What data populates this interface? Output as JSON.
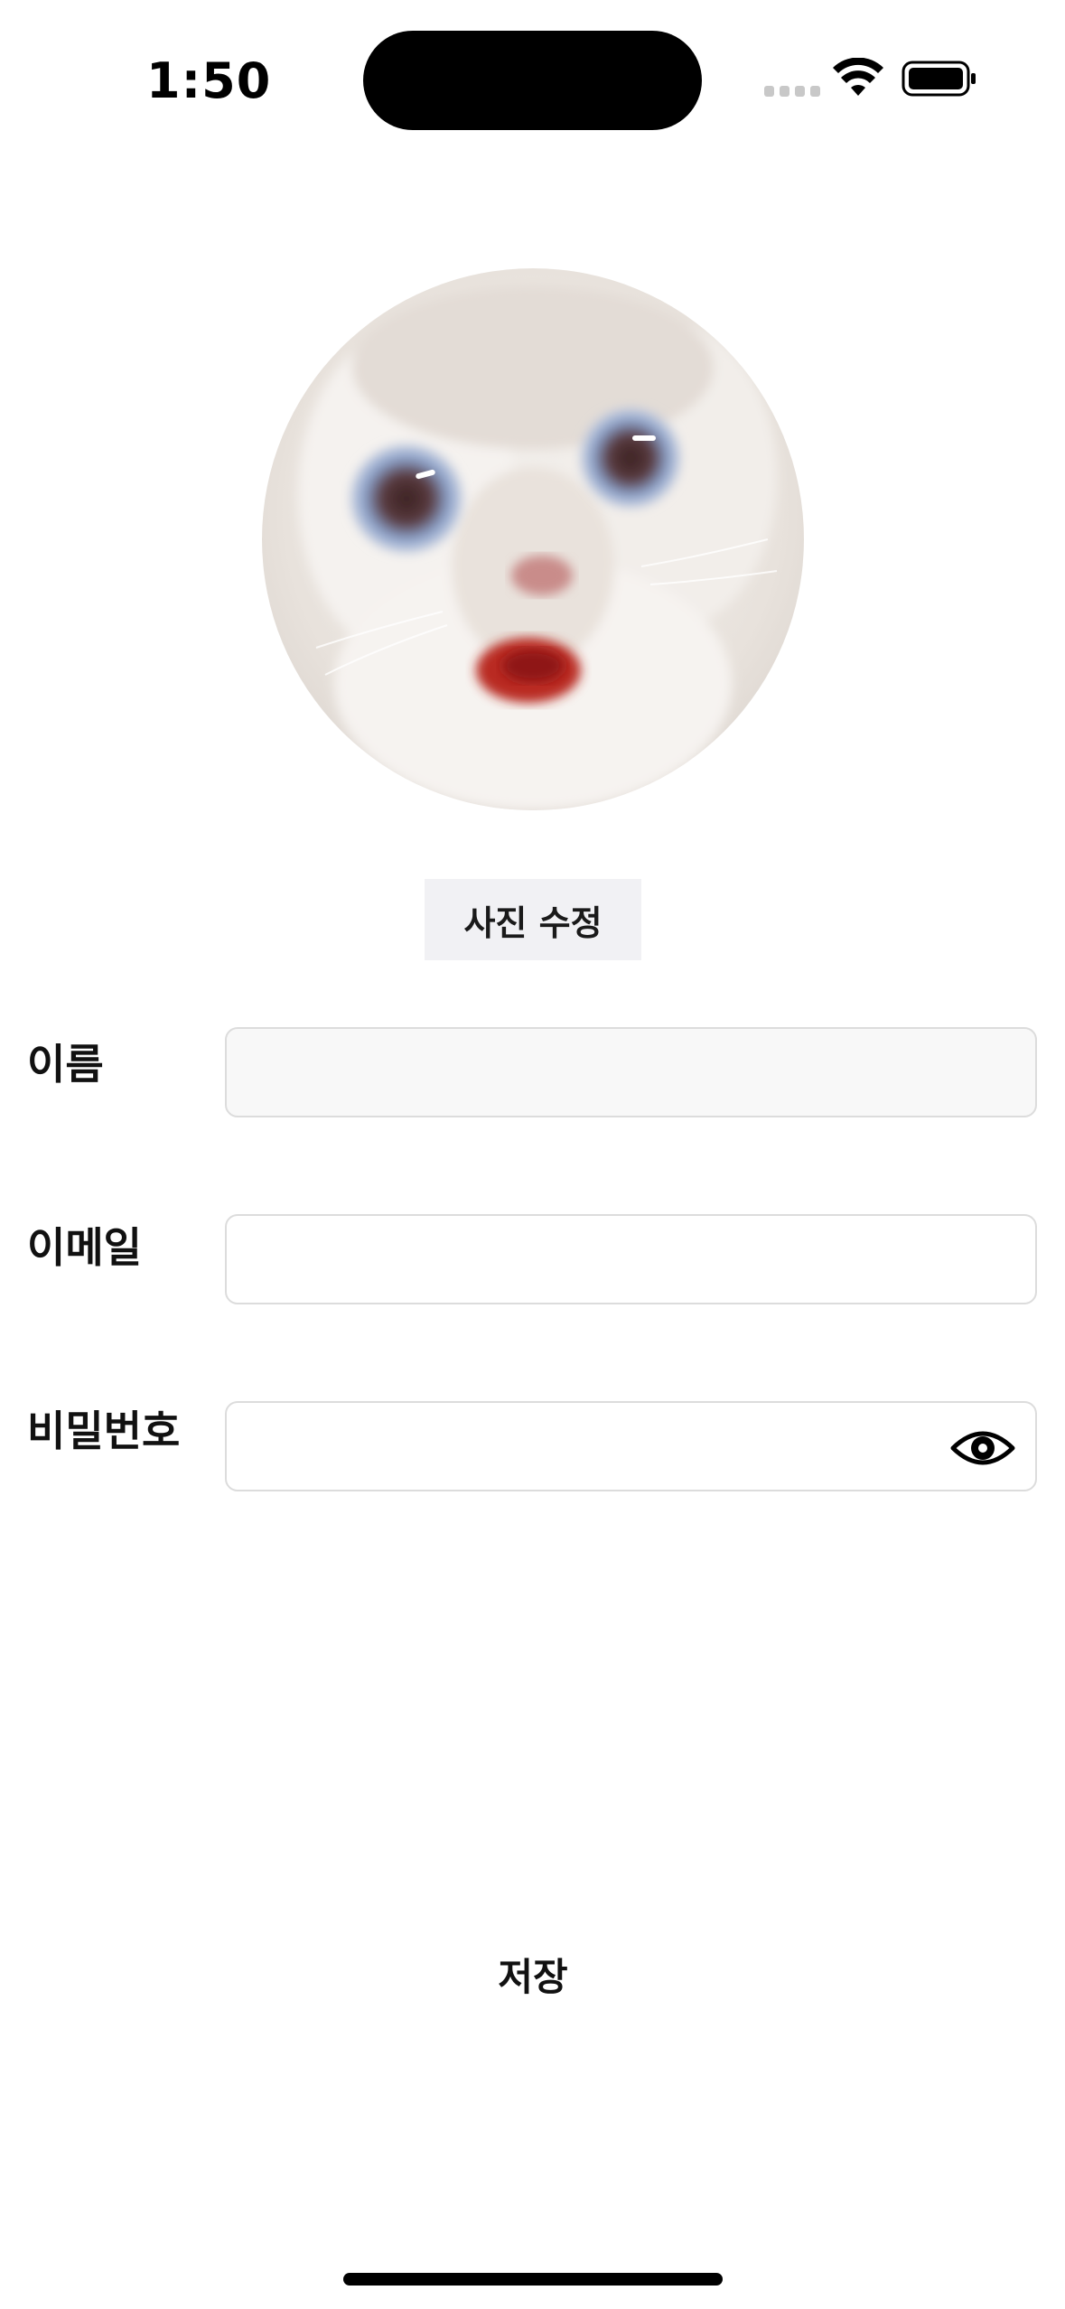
{
  "status_bar": {
    "time": "1:50",
    "icons": [
      "signal-icon",
      "wifi-icon",
      "battery-icon"
    ]
  },
  "profile": {
    "avatar_description": "cat-photo",
    "edit_photo_label": "사진 수정"
  },
  "form": {
    "name_label": "이름",
    "name_value": "",
    "email_label": "이메일",
    "email_value": "",
    "password_label": "비밀번호",
    "password_value": ""
  },
  "actions": {
    "save_label": "저장"
  },
  "colors": {
    "button_bg": "#f1f1f4",
    "input_border": "#dcdcdc",
    "disabled_input_bg": "#f8f8f8"
  }
}
